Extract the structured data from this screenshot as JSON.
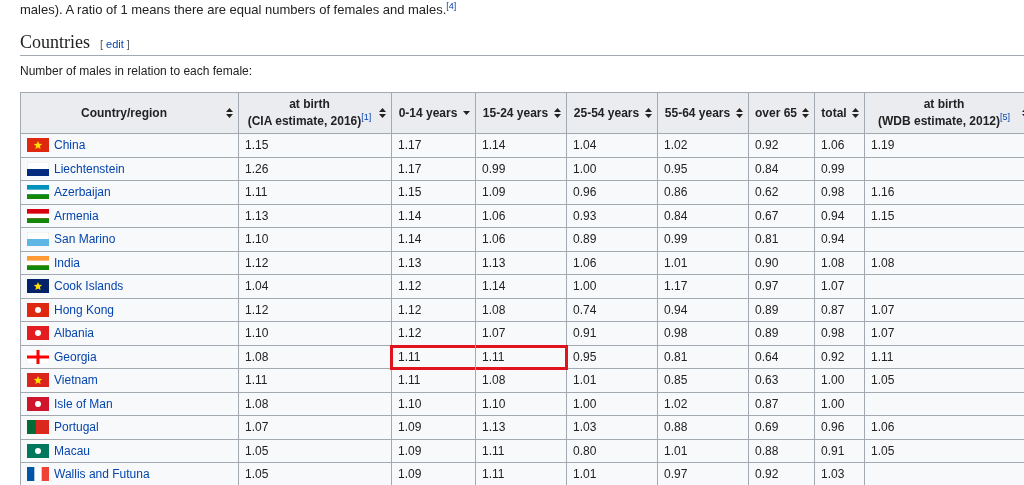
{
  "intro": "males). A ratio of 1 means there are equal numbers of females and males.$^{[4]}$",
  "section": {
    "title": "Countries",
    "edit_open": "[",
    "edit_link": "edit",
    "edit_close": "]"
  },
  "caption": "Number of males in relation to each female:",
  "table": {
    "columns": [
      {
        "label": "Country/region",
        "kind": "unsorted"
      },
      {
        "label": "at birth",
        "sub": "(CIA estimate, 2016)",
        "ref": "[1]",
        "kind": "unsorted"
      },
      {
        "label": "0-14 years",
        "kind": "descending"
      },
      {
        "label": "15-24 years",
        "kind": "unsorted"
      },
      {
        "label": "25-54 years",
        "kind": "unsorted"
      },
      {
        "label": "55-64 years",
        "kind": "unsorted"
      },
      {
        "label": "over 65",
        "kind": "unsorted"
      },
      {
        "label": "total",
        "kind": "unsorted"
      },
      {
        "label": "at birth",
        "sub": "(WDB estimate, 2012)",
        "ref": "[5]",
        "kind": "unsorted"
      }
    ],
    "rows": [
      {
        "country": "China",
        "kind": "star",
        "color": "#de2910",
        "values": [
          {
            "text": "1.15",
            "highlighted": false
          },
          {
            "text": "1.17",
            "highlighted": false
          },
          {
            "text": "1.14",
            "highlighted": false
          },
          {
            "text": "1.04",
            "highlighted": false
          },
          {
            "text": "1.02",
            "highlighted": false
          },
          {
            "text": "0.92",
            "highlighted": false
          },
          {
            "text": "1.06",
            "highlighted": false
          },
          {
            "text": "1.19",
            "highlighted": false
          }
        ]
      },
      {
        "country": "Liechtenstein",
        "kind": "bicolor",
        "color": "#002b7f",
        "values": [
          {
            "text": "1.26",
            "highlighted": false
          },
          {
            "text": "1.17",
            "highlighted": false
          },
          {
            "text": "0.99",
            "highlighted": false
          },
          {
            "text": "1.00",
            "highlighted": false
          },
          {
            "text": "0.95",
            "highlighted": false
          },
          {
            "text": "0.84",
            "highlighted": false
          },
          {
            "text": "0.99",
            "highlighted": false
          },
          {
            "highlighted": false
          }
        ]
      },
      {
        "country": "Azerbaijan",
        "kind": "tricolor",
        "color": "#0092bc",
        "values": [
          {
            "text": "1.11",
            "highlighted": false
          },
          {
            "text": "1.15",
            "highlighted": false
          },
          {
            "text": "1.09",
            "highlighted": false
          },
          {
            "text": "0.96",
            "highlighted": false
          },
          {
            "text": "0.86",
            "highlighted": false
          },
          {
            "text": "0.62",
            "highlighted": false
          },
          {
            "text": "0.98",
            "highlighted": false
          },
          {
            "text": "1.16",
            "highlighted": false
          }
        ]
      },
      {
        "country": "Armenia",
        "kind": "tricolor",
        "color": "#d90012",
        "values": [
          {
            "text": "1.13",
            "highlighted": false
          },
          {
            "text": "1.14",
            "highlighted": false
          },
          {
            "text": "1.06",
            "highlighted": false
          },
          {
            "text": "0.93",
            "highlighted": false
          },
          {
            "text": "0.84",
            "highlighted": false
          },
          {
            "text": "0.67",
            "highlighted": false
          },
          {
            "text": "0.94",
            "highlighted": false
          },
          {
            "text": "1.15",
            "highlighted": false
          }
        ]
      },
      {
        "country": "San Marino",
        "kind": "bicolor",
        "color": "#5eb6e4",
        "values": [
          {
            "text": "1.10",
            "highlighted": false
          },
          {
            "text": "1.14",
            "highlighted": false
          },
          {
            "text": "1.06",
            "highlighted": false
          },
          {
            "text": "0.89",
            "highlighted": false
          },
          {
            "text": "0.99",
            "highlighted": false
          },
          {
            "text": "0.81",
            "highlighted": false
          },
          {
            "text": "0.94",
            "highlighted": false
          },
          {
            "highlighted": false
          }
        ]
      },
      {
        "country": "India",
        "kind": "tricolor",
        "color": "#ff9933",
        "values": [
          {
            "text": "1.12",
            "highlighted": false
          },
          {
            "text": "1.13",
            "highlighted": false
          },
          {
            "text": "1.13",
            "highlighted": false
          },
          {
            "text": "1.06",
            "highlighted": false
          },
          {
            "text": "1.01",
            "highlighted": false
          },
          {
            "text": "0.90",
            "highlighted": false
          },
          {
            "text": "1.08",
            "highlighted": false
          },
          {
            "text": "1.08",
            "highlighted": false
          }
        ]
      },
      {
        "country": "Cook Islands",
        "kind": "star",
        "color": "#012169",
        "values": [
          {
            "text": "1.04",
            "highlighted": false
          },
          {
            "text": "1.12",
            "highlighted": false
          },
          {
            "text": "1.14",
            "highlighted": false
          },
          {
            "text": "1.00",
            "highlighted": false
          },
          {
            "text": "1.17",
            "highlighted": false
          },
          {
            "text": "0.97",
            "highlighted": false
          },
          {
            "text": "1.07",
            "highlighted": false
          },
          {
            "highlighted": false
          }
        ]
      },
      {
        "country": "Hong Kong",
        "kind": "emblem",
        "color": "#de2910",
        "values": [
          {
            "text": "1.12",
            "highlighted": false
          },
          {
            "text": "1.12",
            "highlighted": false
          },
          {
            "text": "1.08",
            "highlighted": false
          },
          {
            "text": "0.74",
            "highlighted": false
          },
          {
            "text": "0.94",
            "highlighted": false
          },
          {
            "text": "0.89",
            "highlighted": false
          },
          {
            "text": "0.87",
            "highlighted": false
          },
          {
            "text": "1.07",
            "highlighted": false
          }
        ]
      },
      {
        "country": "Albania",
        "kind": "emblem",
        "color": "#e41e20",
        "values": [
          {
            "text": "1.10",
            "highlighted": false
          },
          {
            "text": "1.12",
            "highlighted": false
          },
          {
            "text": "1.07",
            "highlighted": false
          },
          {
            "text": "0.91",
            "highlighted": false
          },
          {
            "text": "0.98",
            "highlighted": false
          },
          {
            "text": "0.89",
            "highlighted": false
          },
          {
            "text": "0.98",
            "highlighted": false
          },
          {
            "text": "1.07",
            "highlighted": false
          }
        ]
      },
      {
        "country": "Georgia",
        "kind": "cross",
        "color": "#ff0000",
        "values": [
          {
            "text": "1.08",
            "highlighted": false
          },
          {
            "text": "1.11",
            "highlighted": true
          },
          {
            "text": "1.11",
            "highlighted": true
          },
          {
            "text": "0.95",
            "highlighted": false
          },
          {
            "text": "0.81",
            "highlighted": false
          },
          {
            "text": "0.64",
            "highlighted": false
          },
          {
            "text": "0.92",
            "highlighted": false
          },
          {
            "text": "1.11",
            "highlighted": false
          }
        ]
      },
      {
        "country": "Vietnam",
        "kind": "star",
        "color": "#da251d",
        "values": [
          {
            "text": "1.11",
            "highlighted": false
          },
          {
            "text": "1.11",
            "highlighted": false
          },
          {
            "text": "1.08",
            "highlighted": false
          },
          {
            "text": "1.01",
            "highlighted": false
          },
          {
            "text": "0.85",
            "highlighted": false
          },
          {
            "text": "0.63",
            "highlighted": false
          },
          {
            "text": "1.00",
            "highlighted": false
          },
          {
            "text": "1.05",
            "highlighted": false
          }
        ]
      },
      {
        "country": "Isle of Man",
        "kind": "emblem",
        "color": "#cf142b",
        "values": [
          {
            "text": "1.08",
            "highlighted": false
          },
          {
            "text": "1.10",
            "highlighted": false
          },
          {
            "text": "1.10",
            "highlighted": false
          },
          {
            "text": "1.00",
            "highlighted": false
          },
          {
            "text": "1.02",
            "highlighted": false
          },
          {
            "text": "0.87",
            "highlighted": false
          },
          {
            "text": "1.00",
            "highlighted": false
          },
          {
            "highlighted": false
          }
        ]
      },
      {
        "country": "Portugal",
        "kind": "split",
        "color": "#da291c",
        "values": [
          {
            "text": "1.07",
            "highlighted": false
          },
          {
            "text": "1.09",
            "highlighted": false
          },
          {
            "text": "1.13",
            "highlighted": false
          },
          {
            "text": "1.03",
            "highlighted": false
          },
          {
            "text": "0.88",
            "highlighted": false
          },
          {
            "text": "0.69",
            "highlighted": false
          },
          {
            "text": "0.96",
            "highlighted": false
          },
          {
            "text": "1.06",
            "highlighted": false
          }
        ]
      },
      {
        "country": "Macau",
        "kind": "emblem",
        "color": "#00785e",
        "values": [
          {
            "text": "1.05",
            "highlighted": false
          },
          {
            "text": "1.09",
            "highlighted": false
          },
          {
            "text": "1.11",
            "highlighted": false
          },
          {
            "text": "0.80",
            "highlighted": false
          },
          {
            "text": "1.01",
            "highlighted": false
          },
          {
            "text": "0.88",
            "highlighted": false
          },
          {
            "text": "0.91",
            "highlighted": false
          },
          {
            "text": "1.05",
            "highlighted": false
          }
        ]
      },
      {
        "country": "Wallis and Futuna",
        "kind": "vertical",
        "color": "#ef4135",
        "values": [
          {
            "text": "1.05",
            "highlighted": false
          },
          {
            "text": "1.09",
            "highlighted": false
          },
          {
            "text": "1.11",
            "highlighted": false
          },
          {
            "text": "1.01",
            "highlighted": false
          },
          {
            "text": "0.97",
            "highlighted": false
          },
          {
            "text": "0.92",
            "highlighted": false
          },
          {
            "text": "1.03",
            "highlighted": false
          },
          {
            "highlighted": false
          }
        ]
      }
    ]
  }
}
